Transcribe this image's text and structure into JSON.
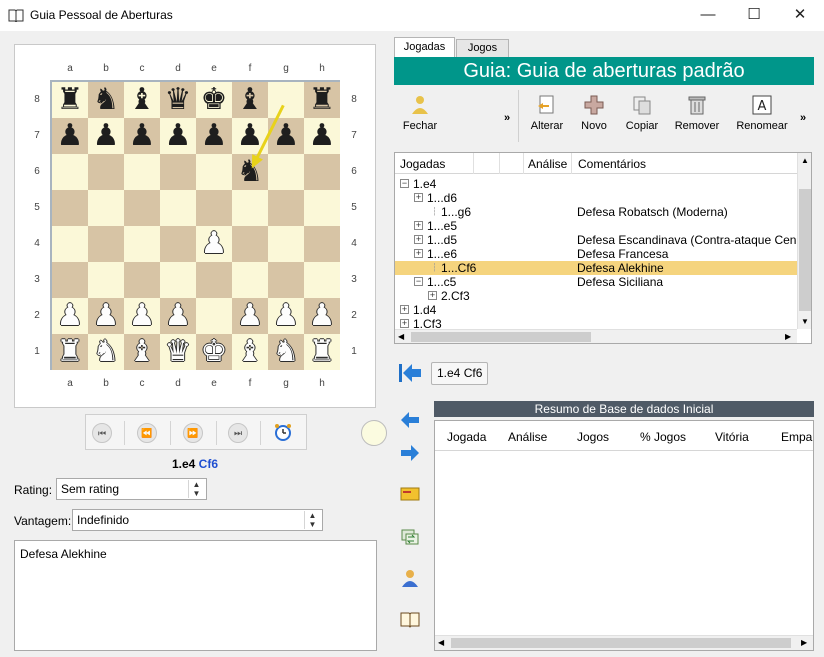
{
  "window": {
    "title": "Guia Pessoal de Aberturas",
    "minimize": "—",
    "maximize": "☐",
    "close": "✕"
  },
  "board": {
    "files": [
      "a",
      "b",
      "c",
      "d",
      "e",
      "f",
      "g",
      "h"
    ],
    "ranks": [
      "8",
      "7",
      "6",
      "5",
      "4",
      "3",
      "2",
      "1"
    ],
    "position": [
      [
        "r",
        "n",
        "b",
        "q",
        "k",
        "b",
        "",
        "r"
      ],
      [
        "p",
        "p",
        "p",
        "p",
        "p",
        "p",
        "p",
        "p"
      ],
      [
        "",
        "",
        "",
        "",
        "",
        "n",
        "",
        ""
      ],
      [
        "",
        "",
        "",
        "",
        "",
        "",
        "",
        ""
      ],
      [
        "",
        "",
        "",
        "",
        "P",
        "",
        "",
        ""
      ],
      [
        "",
        "",
        "",
        "",
        "",
        "",
        "",
        ""
      ],
      [
        "P",
        "P",
        "P",
        "P",
        "",
        "P",
        "P",
        "P"
      ],
      [
        "R",
        "N",
        "B",
        "Q",
        "K",
        "B",
        "N",
        "R"
      ]
    ],
    "last_move_arrow": {
      "from": "g8",
      "to": "f6",
      "color": "#e8d21b"
    }
  },
  "nav": {
    "first": "⏮",
    "prev": "⏪",
    "next": "⏩",
    "last": "⏭",
    "timer_icon": "alarm-clock-icon"
  },
  "current_move": {
    "white": "1.e4",
    "black": "Cf6"
  },
  "rating": {
    "label": "Rating:",
    "value": "Sem rating"
  },
  "advantage": {
    "label": "Vantagem:",
    "value": "Indefinido"
  },
  "comment": "Defesa Alekhine",
  "tabs": [
    "Jogadas",
    "Jogos"
  ],
  "guide_title": "Guia: Guia de aberturas padrão",
  "toolbar": {
    "close_label": "Fechar",
    "more1": "»",
    "edit_label": "Alterar",
    "new_label": "Novo",
    "copy_label": "Copiar",
    "remove_label": "Remover",
    "rename_label": "Renomear",
    "more2": "»"
  },
  "tree": {
    "headers": {
      "moves": "Jogadas",
      "analysis": "Análise",
      "comments": "Comentários"
    },
    "rows": [
      {
        "sign": "⊟",
        "indent": 0,
        "move": "1.e4",
        "comment": "",
        "selected": false
      },
      {
        "sign": "⊞",
        "indent": 1,
        "move": "1...d6",
        "comment": "",
        "selected": false
      },
      {
        "sign": "",
        "indent": 2,
        "move": "1...g6",
        "comment": "Defesa Robatsch (Moderna)",
        "selected": false
      },
      {
        "sign": "⊞",
        "indent": 1,
        "move": "1...e5",
        "comment": "",
        "selected": false
      },
      {
        "sign": "⊞",
        "indent": 1,
        "move": "1...d5",
        "comment": "Defesa Escandinava (Contra-ataque Cen",
        "selected": false
      },
      {
        "sign": "⊞",
        "indent": 1,
        "move": "1...e6",
        "comment": "Defesa Francesa",
        "selected": false
      },
      {
        "sign": "",
        "indent": 2,
        "move": "1...Cf6",
        "comment": "Defesa Alekhine",
        "selected": true
      },
      {
        "sign": "⊟",
        "indent": 1,
        "move": "1...c5",
        "comment": "Defesa Siciliana",
        "selected": false
      },
      {
        "sign": "⊞",
        "indent": 2,
        "move": "2.Cf3",
        "comment": "",
        "selected": false
      },
      {
        "sign": "⊞",
        "indent": 0,
        "move": "1.d4",
        "comment": "",
        "selected": false
      },
      {
        "sign": "⊞",
        "indent": 0,
        "move": "1.Cf3",
        "comment": "",
        "selected": false
      }
    ]
  },
  "history_button": "1.e4 Cf6",
  "db": {
    "title": "Resumo de Base de dados Inicial",
    "headers": [
      "Jogada",
      "Análise",
      "Jogos",
      "% Jogos",
      "Vitória",
      "Empa"
    ]
  }
}
